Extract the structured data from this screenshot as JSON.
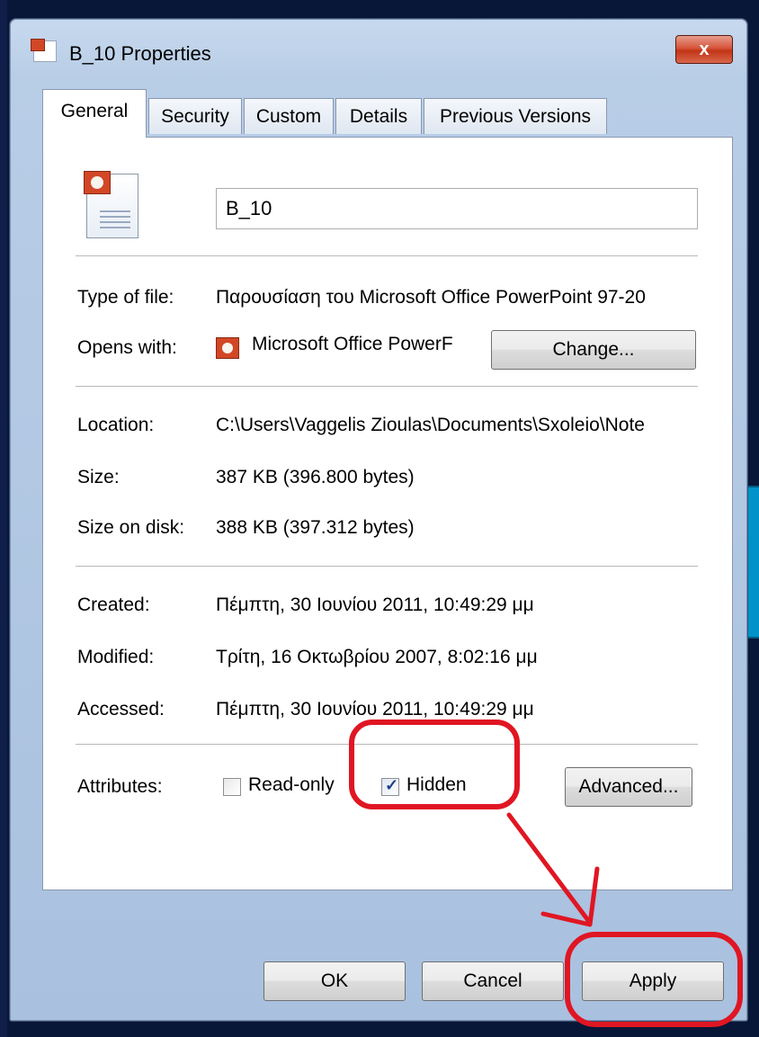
{
  "window": {
    "title": "B_10 Properties",
    "close_glyph": "x"
  },
  "tabs": [
    {
      "label": "General",
      "active": true
    },
    {
      "label": "Security",
      "active": false
    },
    {
      "label": "Custom",
      "active": false
    },
    {
      "label": "Details",
      "active": false
    },
    {
      "label": "Previous Versions",
      "active": false
    }
  ],
  "general": {
    "file_name": "B_10",
    "type_of_file": {
      "label": "Type of file:",
      "value": "Παρουσίαση του Microsoft Office PowerPoint 97-20"
    },
    "opens_with": {
      "label": "Opens with:",
      "value": "Microsoft Office PowerF",
      "change_button": "Change..."
    },
    "location": {
      "label": "Location:",
      "value": "C:\\Users\\Vaggelis Zioulas\\Documents\\Sxoleio\\Note"
    },
    "size": {
      "label": "Size:",
      "value": "387 KB (396.800 bytes)"
    },
    "size_on_disk": {
      "label": "Size on disk:",
      "value": "388 KB (397.312 bytes)"
    },
    "created": {
      "label": "Created:",
      "value": "Πέμπτη, 30 Ιουνίου 2011, 10:49:29 μμ"
    },
    "modified": {
      "label": "Modified:",
      "value": "Τρίτη, 16 Οκτωβρίου 2007, 8:02:16 μμ"
    },
    "accessed": {
      "label": "Accessed:",
      "value": "Πέμπτη, 30 Ιουνίου 2011, 10:49:29 μμ"
    },
    "attributes": {
      "label": "Attributes:",
      "read_only": {
        "label": "Read-only",
        "checked": false
      },
      "hidden": {
        "label": "Hidden",
        "checked": true
      },
      "advanced_button": "Advanced..."
    }
  },
  "footer": {
    "ok": "OK",
    "cancel": "Cancel",
    "apply": "Apply"
  },
  "icons": {
    "title_icon": "powerpoint-document-icon",
    "file_icon": "powerpoint-document-icon",
    "program_icon": "powerpoint-app-icon",
    "check_mark": "✓"
  },
  "colors": {
    "annotation_red": "#e01623",
    "accent_blue": "#0092c9"
  }
}
